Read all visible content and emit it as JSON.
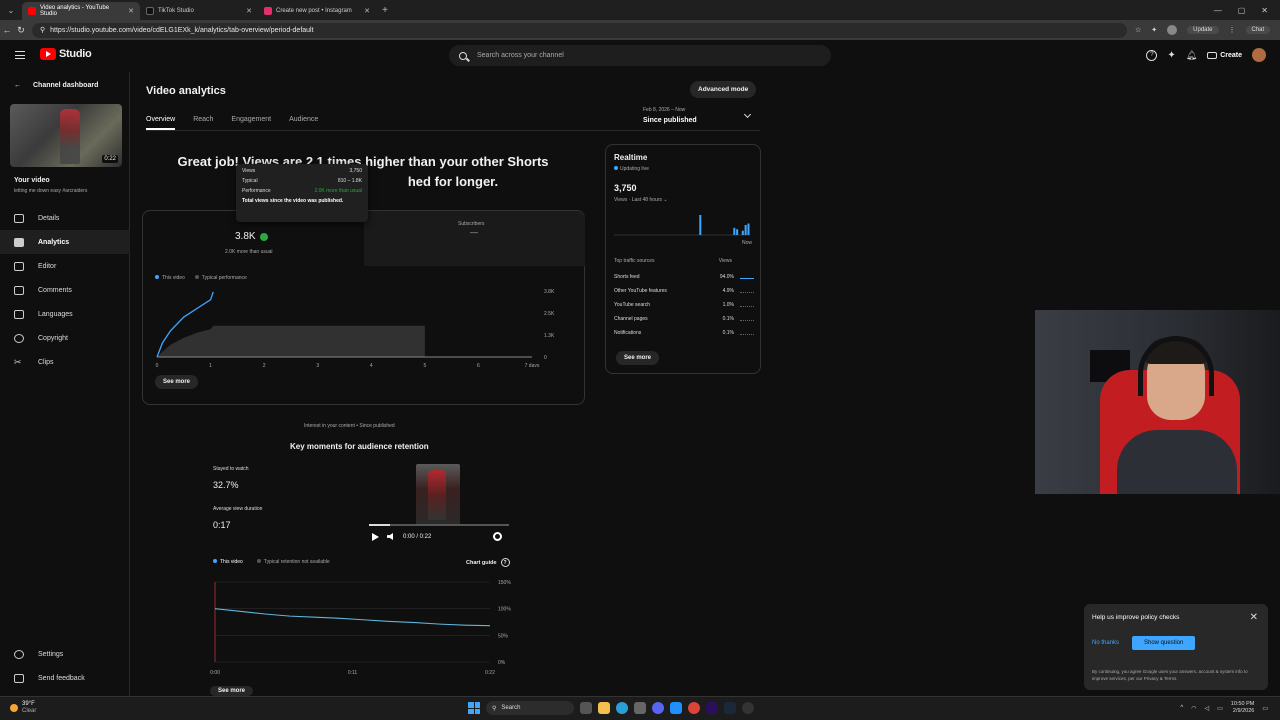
{
  "browser": {
    "tabs": [
      {
        "label": "Video analytics - YouTube Studio",
        "color": "#ff0000",
        "active": true
      },
      {
        "label": "TikTok Studio",
        "color": "#111111",
        "active": false
      },
      {
        "label": "Create new post • Instagram",
        "color": "#e1306c",
        "active": false
      }
    ],
    "url": "https://studio.youtube.com/video/cdELG1EXk_k/analytics/tab-overview/period-default",
    "update_label": "Update",
    "chat_label": "Chat"
  },
  "header": {
    "logo_text": "Studio",
    "search_placeholder": "Search across your channel",
    "create_label": "Create"
  },
  "sidebar": {
    "back_label": "Channel dashboard",
    "thumb_duration": "0:22",
    "your_video": "Your video",
    "video_title": "letting me down easy #arcraiders",
    "items": [
      {
        "label": "Details",
        "icon": "pencil-icon"
      },
      {
        "label": "Analytics",
        "icon": "analytics-icon"
      },
      {
        "label": "Editor",
        "icon": "editor-icon"
      },
      {
        "label": "Comments",
        "icon": "comments-icon"
      },
      {
        "label": "Languages",
        "icon": "languages-icon"
      },
      {
        "label": "Copyright",
        "icon": "copyright-icon"
      },
      {
        "label": "Clips",
        "icon": "scissors-icon"
      }
    ],
    "bottom": [
      {
        "label": "Settings",
        "icon": "gear-icon"
      },
      {
        "label": "Send feedback",
        "icon": "feedback-icon"
      }
    ]
  },
  "main": {
    "title": "Video analytics",
    "advanced_mode": "Advanced mode",
    "tabs": [
      "Overview",
      "Reach",
      "Engagement",
      "Audience"
    ],
    "period_range": "Feb 8, 2026 – Now",
    "period_label": "Since published",
    "headline_line1": "Great job! Views are 2.1 times higher than your other Shorts",
    "headline_line2": "hed for longer.",
    "views_value": "3.8K",
    "views_sub": "2.0K more than usual",
    "subs_label": "Subscribers",
    "subs_value": "—",
    "legend_this": "This video",
    "legend_typical": "Typical performance",
    "see_more": "See more"
  },
  "tooltip": {
    "views_label": "Views",
    "views_value": "3,750",
    "typical_label": "Typical",
    "typical_value": "810 – 1.8K",
    "performance_label": "Performance",
    "performance_value": "2.0K more than usual",
    "footer": "Total views since the video was published."
  },
  "chart_data": [
    {
      "type": "line",
      "x": [
        0,
        0.1,
        0.25,
        0.5,
        0.75,
        1,
        1.05
      ],
      "series": [
        {
          "name": "This video",
          "values": [
            0,
            800,
            1500,
            2300,
            2800,
            3300,
            3750
          ]
        },
        {
          "name": "Typical performance",
          "band_low": [
            0,
            100,
            300,
            500,
            650,
            750,
            810
          ],
          "band_high": [
            0,
            300,
            700,
            1100,
            1400,
            1600,
            1800
          ]
        }
      ],
      "typical_band_to": 5,
      "xticks": [
        "0",
        "1",
        "2",
        "3",
        "4",
        "5",
        "6",
        "7 days"
      ],
      "yticks": [
        "3.8K",
        "2.5K",
        "1.3K",
        "0"
      ],
      "ylim": [
        0,
        3800
      ]
    },
    {
      "type": "bar",
      "xlabel": "Views · Last 48 hours",
      "values": [
        0,
        0,
        0,
        0,
        0,
        0,
        0,
        0,
        0,
        0,
        0,
        0,
        0,
        0,
        0,
        0,
        0,
        0,
        0,
        0,
        0,
        0,
        0,
        0,
        0,
        0,
        0,
        0,
        0,
        0,
        14,
        0,
        0,
        0,
        0,
        0,
        0,
        0,
        0,
        0,
        0,
        0,
        5,
        4,
        0,
        3,
        7,
        8
      ]
    },
    {
      "type": "line",
      "x": [
        0,
        0.02,
        0.04,
        0.06,
        0.08,
        0.1,
        0.12,
        0.14,
        0.16,
        0.18,
        0.2,
        0.22
      ],
      "series": [
        {
          "name": "This video",
          "values": [
            100,
            95,
            90,
            86,
            84,
            82,
            79,
            76,
            74,
            71,
            69,
            68
          ]
        }
      ],
      "xticks": [
        "0:00",
        "0:11",
        "0:22"
      ],
      "yticks": [
        "150%",
        "100%",
        "50%",
        "0%"
      ],
      "ylim": [
        0,
        150
      ]
    }
  ],
  "realtime": {
    "title": "Realtime",
    "live": "Updating live",
    "views": "3,750",
    "sub": "Views · Last 48 hours",
    "now": "Now",
    "sources_header": "Top traffic sources",
    "views_header": "Views",
    "sources": [
      {
        "name": "Shorts feed",
        "value": "94.0%"
      },
      {
        "name": "Other YouTube features",
        "value": "4.9%"
      },
      {
        "name": "YouTube search",
        "value": "1.0%"
      },
      {
        "name": "Channel pages",
        "value": "0.1%"
      },
      {
        "name": "Notifications",
        "value": "0.1%"
      }
    ],
    "see_more": "See more"
  },
  "retention": {
    "interest": "Interest in your content • Since published",
    "title": "Key moments for audience retention",
    "stayed_label": "Stayed to watch",
    "stayed_value": "32.7%",
    "avd_label": "Average view duration",
    "avd_value": "0:17",
    "time": "0:00 / 0:22",
    "legend_this": "This video",
    "legend_typical": "Typical retention not available",
    "chart_guide": "Chart guide",
    "see_more": "See more"
  },
  "policy": {
    "title": "Help us improve policy checks",
    "no_thanks": "No thanks",
    "show": "Show question",
    "fine_print": "By continuing, you agree Google uses your answers, account & system info to improve services, per our Privacy & Terms."
  },
  "taskbar": {
    "temp": "39°F",
    "weather": "Clear",
    "search": "Search",
    "time": "10:50 PM",
    "date": "2/9/2026"
  }
}
